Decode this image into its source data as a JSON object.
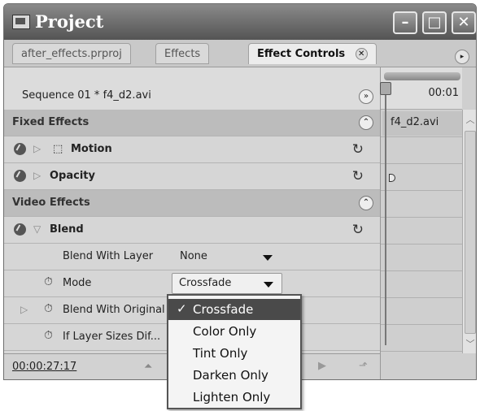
{
  "window": {
    "title": "Project",
    "controls": [
      "minimize-icon",
      "maximize-icon",
      "close-icon"
    ]
  },
  "tabs": [
    {
      "label": "after_effects.prproj",
      "active": false
    },
    {
      "label": "Effects",
      "active": false
    },
    {
      "label": "Effect Controls",
      "active": true,
      "close_glyph": "✕"
    }
  ],
  "panel_menu_glyph": "▸",
  "sequence_label": "Sequence 01 * f4_d2.avi",
  "sequence_toggle_glyph": "»",
  "sections": {
    "fixed_effects": {
      "label": "Fixed Effects",
      "collapse_glyph": "⌃"
    },
    "video_effects": {
      "label": "Video Effects",
      "collapse_glyph": "⌃"
    }
  },
  "effects": {
    "motion": {
      "label": "Motion",
      "icon": "motion-transform-icon"
    },
    "opacity": {
      "label": "Opacity"
    },
    "blend": {
      "label": "Blend",
      "properties": [
        {
          "label": "Blend With Layer",
          "value": "None"
        },
        {
          "label": "Mode",
          "value": "Crossfade"
        },
        {
          "label": "Blend With Original"
        },
        {
          "label": "If Layer Sizes Dif..."
        }
      ]
    }
  },
  "reset_glyph": "↻",
  "stopwatch_glyph": "⏱",
  "twirl_closed": "▷",
  "twirl_open": "▽",
  "timeline": {
    "time": "00:01",
    "clip_name": "f4_d2.avi"
  },
  "footer": {
    "timecode": "00:00:27:17"
  },
  "mode_menu": {
    "items": [
      "Crossfade",
      "Color Only",
      "Tint Only",
      "Darken Only",
      "Lighten Only"
    ],
    "selected": "Crossfade",
    "check_glyph": "✓"
  },
  "colors": {
    "titlebar": "#545454",
    "section_row": "#bcbcbc",
    "menu_highlight": "#4a4a4a"
  }
}
